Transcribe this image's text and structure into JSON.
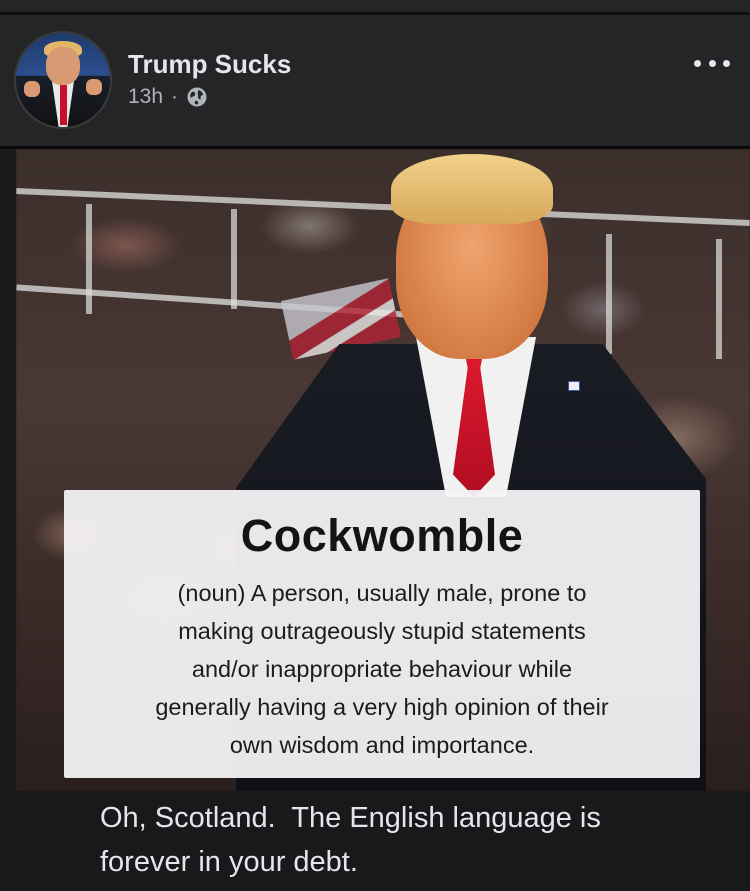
{
  "post": {
    "author_name": "Trump Sucks",
    "timestamp": "13h",
    "separator": "·",
    "audience_icon": "globe-icon",
    "more_icon": "more-horizontal-icon"
  },
  "image": {
    "word": "Cockwomble",
    "definition_lines": [
      "(noun) A person, usually male, prone to",
      "making outrageously stupid statements",
      "and/or inappropriate behaviour while",
      "generally having a very high opinion of their",
      "own wisdom and importance."
    ],
    "caption_lines": [
      "Oh, Scotland.  The English language is",
      "forever in your debt."
    ]
  },
  "colors": {
    "background": "#18191a",
    "header_background": "#242526",
    "tie_red": "#c8102e",
    "definition_box": "#f4f2f4"
  }
}
